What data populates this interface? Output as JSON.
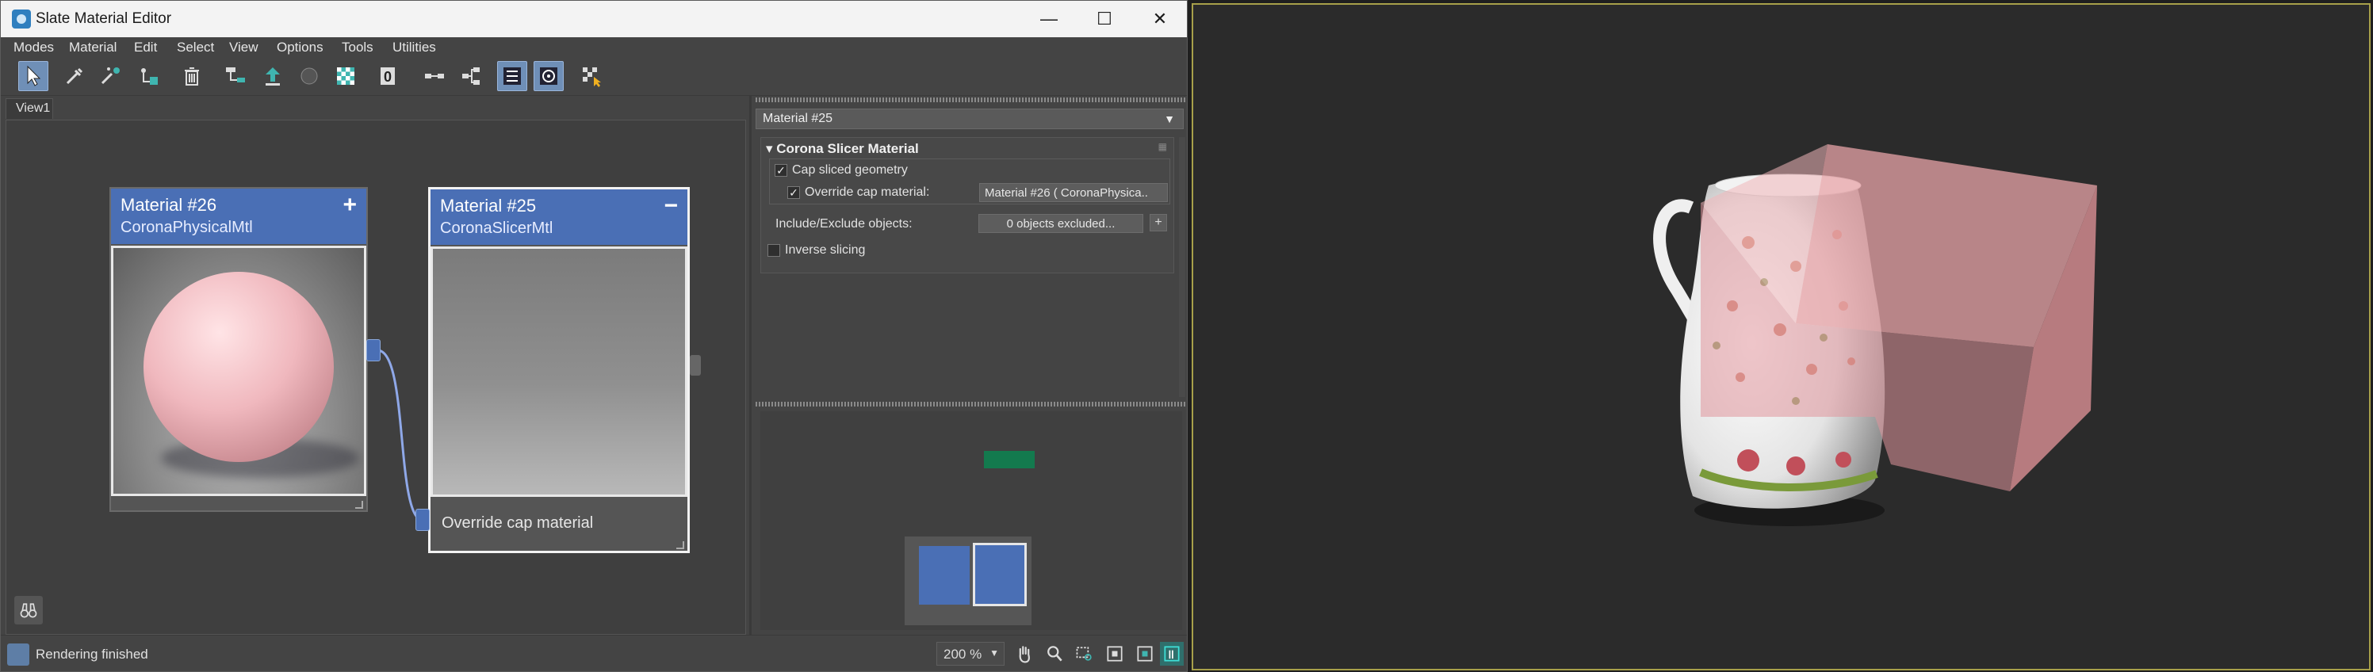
{
  "window": {
    "title": "Slate Material Editor",
    "minimize": "—",
    "maximize": "☐",
    "close": "✕"
  },
  "menu": [
    "Modes",
    "Material",
    "Edit",
    "Select",
    "View",
    "Options",
    "Tools",
    "Utilities"
  ],
  "view_tab": "View1",
  "nodes": {
    "material26": {
      "name": "Material #26",
      "type": "CoronaPhysicalMtl",
      "toggle": "+"
    },
    "material25": {
      "name": "Material #25",
      "type": "CoronaSlicerMtl",
      "toggle": "−",
      "slot": "Override cap material"
    }
  },
  "params": {
    "selected_material": "Material #25",
    "rollout_title": "Corona Slicer Material",
    "cap_sliced_geometry": {
      "label": "Cap sliced geometry",
      "checked": true
    },
    "override_cap_material": {
      "label": "Override cap material:",
      "checked": true,
      "value": "Material #26  (  CoronaPhysica.."
    },
    "include_exclude": {
      "label": "Include/Exclude objects:",
      "value": "0 objects excluded...",
      "plus": "+"
    },
    "inverse_slicing": {
      "label": "Inverse slicing",
      "checked": false
    }
  },
  "status": {
    "text": "Rendering finished",
    "zoom": "200 %"
  },
  "colors": {
    "node_header": "#4a6fb5",
    "nav_green": "#137a4e",
    "viewport_border": "#a7a04a",
    "slicer_box": "#e8a4a8"
  }
}
